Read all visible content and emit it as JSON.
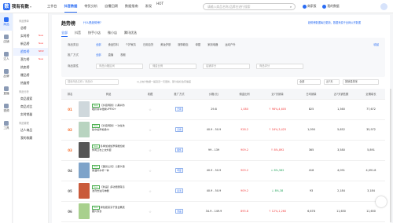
{
  "app": {
    "logo_text": "我有有数",
    "logo_letter": "数"
  },
  "topnav": [
    {
      "label": "工作台",
      "active": false
    },
    {
      "label": "抖音数据",
      "active": true
    },
    {
      "label": "带货分析",
      "active": false
    },
    {
      "label": "自播回溯",
      "active": false
    },
    {
      "label": "数据指南",
      "active": false
    },
    {
      "label": "发现",
      "active": false,
      "hot": "HOT"
    }
  ],
  "search": {
    "placeholder": "请输入商品名称/品牌名进行搜索"
  },
  "topright": {
    "items": [
      "商家版",
      "我的数据"
    ]
  },
  "sidebar1": [
    {
      "label": "商品",
      "active": true
    },
    {
      "label": "店铺",
      "active": false
    },
    {
      "label": "达人",
      "active": false
    },
    {
      "label": "品牌",
      "active": false
    },
    {
      "label": "直播",
      "active": false
    },
    {
      "label": "视频",
      "active": false
    },
    {
      "label": "工具",
      "active": false
    }
  ],
  "sidebar2": {
    "groups": [
      {
        "title": "商品榜单",
        "items": [
          {
            "label": "总榜",
            "active": false
          },
          {
            "label": "实时榜",
            "active": false,
            "tag": "New"
          },
          {
            "label": "新品榜",
            "active": false,
            "tag": "New"
          },
          {
            "label": "趋势榜",
            "active": true,
            "tag": "NEW"
          },
          {
            "label": "潜力榜",
            "active": false,
            "tag": "New"
          },
          {
            "label": "热卖榜",
            "active": false
          },
          {
            "label": "爆品榜",
            "active": false
          },
          {
            "label": "热度榜",
            "active": false
          }
        ]
      },
      {
        "title": "商品分析",
        "items": [
          {
            "label": "商品搜索",
            "active": false
          },
          {
            "label": "商品对比",
            "active": false
          },
          {
            "label": "实时销量",
            "active": false
          }
        ]
      },
      {
        "title": "商品管理",
        "items": [
          {
            "label": "达人商品",
            "active": false
          },
          {
            "label": "我的收藏",
            "active": false
          }
        ]
      }
    ]
  },
  "main": {
    "title": "趋势榜",
    "title_link": "什么是趋势榜?",
    "notice": "趋势榜数据每日更新，数据来源于全网公开数据",
    "tabs": [
      {
        "label": "全部",
        "active": true
      },
      {
        "label": "抖音",
        "active": false
      },
      {
        "label": "快手小店",
        "active": false
      },
      {
        "label": "微小店",
        "active": false
      },
      {
        "label": "腾讯优选",
        "active": false
      }
    ]
  },
  "filters": {
    "row1": {
      "label": "商品类目",
      "chips": [
        "全部",
        "食品饮料",
        "个护家清",
        "日用百货",
        "美妆护肤",
        "服饰鞋包",
        "母婴",
        "家用电器",
        "运动户外"
      ],
      "selected": 0
    },
    "row2": {
      "label": "推广方式",
      "chips": [
        "全部",
        "直播",
        "视频"
      ],
      "selected": 0
    },
    "row3": {
      "label": "商品属性",
      "selects": [
        "商品价格区间",
        "佣金比例",
        "店铺评分",
        "商品评分"
      ]
    },
    "collapse": "收起"
  },
  "searchbar": {
    "placeholder": "搜索商品名称 / 商品ID",
    "hint": "以上统计数据一般延迟一天更新，部分指标会有偏差",
    "sort1": "全部",
    "sort2": "近7天",
    "sort3": "按销量排序"
  },
  "table": {
    "headers": [
      "排名",
      "商品",
      "收藏",
      "推广方式",
      "价格(元)",
      "佣金比例",
      "近7天销量",
      "日均销量",
      "近7天销售额",
      "近期增长"
    ],
    "rows": [
      {
        "rank": "01",
        "title": "【抖音同款】小黑伞防晒折叠伞便携UPF50+",
        "badge": "New",
        "tag": "日用",
        "promo": "",
        "price": "29.8",
        "rate": "1,080",
        "sales": "98%,4,605",
        "daily": "825",
        "gmv": "1,360",
        "growth": "77,672",
        "dir": "up",
        "color": "#cfd8dc"
      },
      {
        "rank": "02",
        "title": "【抖音同款】一次性洗脸巾加厚棉柔巾",
        "badge": "New",
        "tag": "日用",
        "promo": "",
        "price": "40.9 - 50.9",
        "rate": "928.2",
        "sales": "16%,3,425",
        "daily": "1,090",
        "gmv": "5,652",
        "growth": "35,972",
        "dir": "up",
        "color": "#b8d4c0"
      },
      {
        "rank": "03",
        "title": "冬季加绒加厚保暖加绒休闲卫衣上衣外套",
        "badge": "New",
        "tag": "服饰",
        "promo": "",
        "price": "99 - 139",
        "rate": "909.2",
        "sales": "8%,892",
        "daily": "365",
        "gmv": "3,580",
        "growth": "5,891",
        "dir": "up",
        "color": "#555"
      },
      {
        "rank": "04",
        "title": "【国货之光】儿童卡通保温杯水杯一体",
        "badge": "New",
        "tag": "母婴",
        "promo": "直播",
        "price": "40.9 - 50.9",
        "rate": "909.2",
        "sales": "8%,582",
        "daily": "418",
        "gmv": "4,091",
        "growth": "4,091.8",
        "dir": "down",
        "color": "#7ea3c9"
      },
      {
        "rank": "05",
        "title": "【新品】多功能厨房清洁剂去油污神器",
        "badge": "New",
        "tag": "家清",
        "promo": "",
        "price": "40.9 - 50.9",
        "rate": "909.2",
        "sales": "8%,38",
        "daily": "93",
        "gmv": "2,184",
        "growth": "3,184",
        "dir": "down",
        "color": "#c95a3a"
      },
      {
        "rank": "06",
        "title": "绿色蔬菜冻干混合果蔬脆片零食",
        "badge": "New",
        "tag": "食品",
        "promo": "",
        "price": "34.9 - 149.9",
        "rate": "895.8",
        "sales": "12%,1,260",
        "daily": "6,678",
        "gmv": "11,650",
        "growth": "11,650",
        "dir": "up",
        "color": "#a8d08d"
      }
    ]
  }
}
